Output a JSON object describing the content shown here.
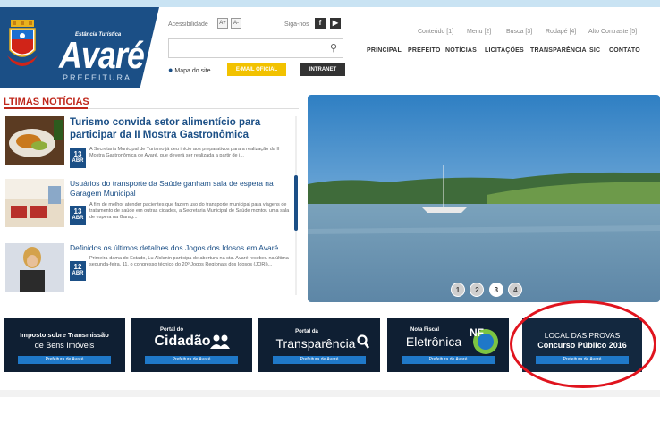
{
  "header": {
    "brand": "Avaré",
    "brand_subtitle": "Estância Turística",
    "brand_tagline": "PREFEITURA",
    "accessibility_label": "Acessibilidade",
    "font_increase": "A+",
    "font_decrease": "A-",
    "follow_label": "Siga-nos",
    "facebook": "f",
    "youtube": "▶",
    "map_link": "Mapa do site",
    "email_button": "E-MAIL OFICIAL",
    "intranet_button": "INTRANET"
  },
  "quick_links": [
    "Conteúdo [1]",
    "Menu [2]",
    "Busca [3]",
    "Rodapé [4]",
    "Alto Contraste [5]"
  ],
  "nav": [
    "PRINCIPAL",
    "PREFEITO",
    "NOTÍCIAS",
    "LICITAÇÕES",
    "TRANSPARÊNCIA",
    "SIC",
    "CONTATO"
  ],
  "news_section": {
    "title": "LTIMAS NOTÍCIAS",
    "items": [
      {
        "title": "Turismo convida setor alimentício para participar da II Mostra Gastronômica",
        "day": "13",
        "month": "ABR",
        "desc": "A Secretaria Municipal de Turismo já deu início aos preparativos para a realização da II Mostra Gastronômica de Avaré, que deverá ser realizada a partir de j..."
      },
      {
        "title": "Usuários do transporte da Saúde ganham sala de espera na Garagem Municipal",
        "day": "13",
        "month": "ABR",
        "desc": "A fim de melhor atender pacientes que fazem uso do transporte municipal para viagens de tratamento de saúde em outras cidades, a Secretaria Municipal de Saúde montou uma sala de espera na Garag..."
      },
      {
        "title": "Definidos os últimos detalhes dos Jogos dos Idosos em Avaré",
        "day": "12",
        "month": "ABR",
        "desc": "Primeira-dama do Estado, Lu Alckmin participa de abertura na sta. Avaré recebeu na última segunda-feira, 11, o congresso técnico do 20º Jogos Regionais dos Idosos (JORI)..."
      }
    ]
  },
  "slider": {
    "dots": [
      "1",
      "2",
      "3",
      "4"
    ],
    "active_index": 3
  },
  "banners": [
    {
      "line1": "Imposto sobre Transmissão",
      "line2": "de Bens Imóveis",
      "bar": "Prefeitura de Avaré"
    },
    {
      "line1": "Portal do",
      "line2": "Cidadão",
      "bar": "Prefeitura de Avaré"
    },
    {
      "line1": "Portal da",
      "line2": "Transparência",
      "bar": "Prefeitura de Avaré"
    },
    {
      "line1": "Nota Fiscal",
      "line2": "Eletrônica",
      "bar": "Prefeitura de Avaré"
    },
    {
      "line1": "LOCAL DAS PROVAS",
      "line2": "Concurso Público 2016",
      "bar": "Prefeitura de Avaré"
    }
  ],
  "colors": {
    "brand_blue": "#1b4f86",
    "news_red": "#c0281c",
    "email_yellow": "#f2c200",
    "highlight_circle": "#e0141e"
  }
}
